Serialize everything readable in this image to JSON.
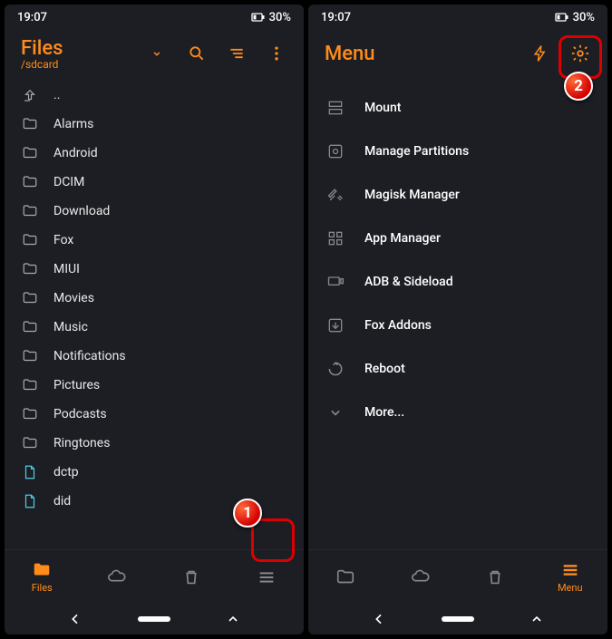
{
  "status": {
    "time": "19:07",
    "battery": "30%"
  },
  "left": {
    "title": "Files",
    "path": "/sdcard",
    "items": [
      {
        "type": "up",
        "label": ".."
      },
      {
        "type": "folder",
        "label": "Alarms"
      },
      {
        "type": "folder",
        "label": "Android"
      },
      {
        "type": "folder",
        "label": "DCIM"
      },
      {
        "type": "folder",
        "label": "Download"
      },
      {
        "type": "folder",
        "label": "Fox"
      },
      {
        "type": "folder",
        "label": "MIUI"
      },
      {
        "type": "folder",
        "label": "Movies"
      },
      {
        "type": "folder",
        "label": "Music"
      },
      {
        "type": "folder",
        "label": "Notifications"
      },
      {
        "type": "folder",
        "label": "Pictures"
      },
      {
        "type": "folder",
        "label": "Podcasts"
      },
      {
        "type": "folder",
        "label": "Ringtones"
      },
      {
        "type": "file",
        "label": "dctp"
      },
      {
        "type": "file",
        "label": "did"
      }
    ],
    "nav": {
      "files": "Files"
    }
  },
  "right": {
    "title": "Menu",
    "items": [
      {
        "icon": "mount",
        "label": "Mount"
      },
      {
        "icon": "partition",
        "label": "Manage Partitions"
      },
      {
        "icon": "magisk",
        "label": "Magisk Manager"
      },
      {
        "icon": "apps",
        "label": "App Manager"
      },
      {
        "icon": "adb",
        "label": "ADB & Sideload"
      },
      {
        "icon": "addons",
        "label": "Fox Addons"
      },
      {
        "icon": "reboot",
        "label": "Reboot"
      },
      {
        "icon": "more",
        "label": "More..."
      }
    ],
    "nav": {
      "menu": "Menu"
    }
  },
  "callouts": {
    "one": "1",
    "two": "2"
  }
}
